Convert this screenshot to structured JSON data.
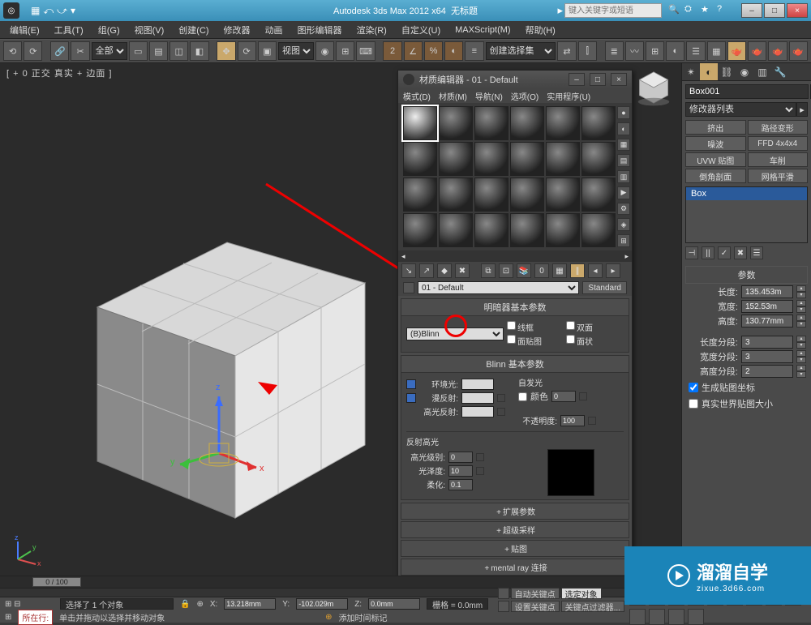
{
  "titlebar": {
    "app_title": "Autodesk 3ds Max 2012 x64",
    "doc_title": "无标题",
    "search_placeholder": "键入关键字或短语",
    "min": "–",
    "max": "□",
    "close": "×"
  },
  "menubar": {
    "items": [
      "编辑(E)",
      "工具(T)",
      "组(G)",
      "视图(V)",
      "创建(C)",
      "修改器",
      "动画",
      "图形编辑器",
      "渲染(R)",
      "自定义(U)",
      "MAXScript(M)",
      "帮助(H)"
    ]
  },
  "maintoolbar": {
    "dropdown_all": "全部",
    "dropdown_view": "视图",
    "dropdown_selset": "创建选择集"
  },
  "viewport": {
    "label": "[ + 0 正交 真实 + 边面 ]"
  },
  "matedit": {
    "title": "材质编辑器 - 01 - Default",
    "menu": [
      "模式(D)",
      "材质(M)",
      "导航(N)",
      "选项(O)",
      "实用程序(U)"
    ],
    "material_name": "01 - Default",
    "type_btn": "Standard",
    "roll_shader_head": "明暗器基本参数",
    "shader_name": "(B)Blinn",
    "chk_wire": "线框",
    "chk_2side": "双面",
    "chk_facemap": "面贴图",
    "chk_faceted": "面状",
    "roll_blinn_head": "Blinn 基本参数",
    "lbl_ambient": "环境光:",
    "lbl_diffuse": "漫反射:",
    "lbl_specular": "高光反射:",
    "grp_selfillum": "自发光",
    "lbl_color_chk": "颜色",
    "val_selfillum": "0",
    "lbl_opacity": "不透明度:",
    "val_opacity": "100",
    "grp_spec": "反射高光",
    "lbl_spec_level": "高光级别:",
    "val_spec_level": "0",
    "lbl_gloss": "光泽度:",
    "val_gloss": "10",
    "lbl_soften": "柔化:",
    "val_soften": "0.1",
    "collapsed": [
      "扩展参数",
      "超级采样",
      "贴图",
      "mental ray 连接"
    ]
  },
  "cmdpanel": {
    "object_name": "Box001",
    "modlist_label": "修改器列表",
    "buttons": [
      "挤出",
      "路径变形",
      "噪波",
      "FFD 4x4x4",
      "UVW 贴图",
      "车削",
      "倒角剖面",
      "网格平滑"
    ],
    "stack_item": "Box",
    "roll_params": "参数",
    "lbl_length": "长度:",
    "val_length": "135.453m",
    "lbl_width": "宽度:",
    "val_width": "152.53m",
    "lbl_height": "高度:",
    "val_height": "130.77mm",
    "lbl_lsegs": "长度分段:",
    "val_lsegs": "3",
    "lbl_wsegs": "宽度分段:",
    "val_wsegs": "3",
    "lbl_hsegs": "高度分段:",
    "val_hsegs": "2",
    "chk_genmap": "生成贴图坐标",
    "chk_realworld": "真实世界贴图大小"
  },
  "status": {
    "selected": "选择了 1 个对象",
    "x": "13.218mm",
    "y": "-102.029m",
    "z": "0.0mm",
    "grid": "栅格 = 0.0mm",
    "autokey": "自动关键点",
    "selfilter": "选定对象",
    "setkey": "设置关键点",
    "keyfilters": "关键点过滤器...",
    "addtime": "添加时间标记",
    "frame_handle": "0 / 100",
    "listener_prefix": "所在行:",
    "prompt": "单击并拖动以选择并移动对象"
  },
  "watermark": {
    "big": "溜溜自学",
    "small": "zixue.3d66.com"
  }
}
